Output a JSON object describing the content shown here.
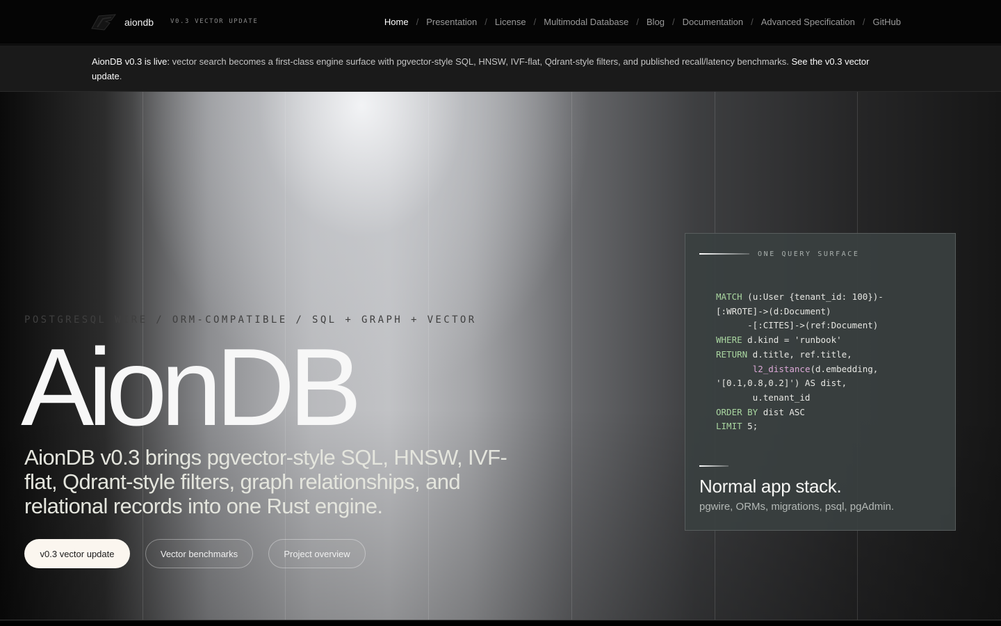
{
  "header": {
    "brand": "aiondb",
    "version_tag": "V0.3 VECTOR UPDATE",
    "logo_icon": "aiondb-logo-icon",
    "nav": [
      {
        "label": "Home",
        "active": true
      },
      {
        "label": "Presentation",
        "active": false
      },
      {
        "label": "License",
        "active": false
      },
      {
        "label": "Multimodal Database",
        "active": false
      },
      {
        "label": "Blog",
        "active": false
      },
      {
        "label": "Documentation",
        "active": false
      },
      {
        "label": "Advanced Specification",
        "active": false
      },
      {
        "label": "GitHub",
        "active": false
      }
    ],
    "separator": "/"
  },
  "announcement": {
    "lead": "AionDB v0.3 is live:",
    "body": " vector search becomes a first-class engine surface with pgvector-style SQL, HNSW, IVF-flat, Qdrant-style filters, and published recall/latency benchmarks. ",
    "link": "See the v0.3 vector update",
    "tail": "."
  },
  "hero": {
    "eyebrow": "POSTGRESQL WIRE / ORM-COMPATIBLE / SQL + GRAPH + VECTOR",
    "title": "AionDB",
    "subtitle": "AionDB v0.3 brings pgvector-style SQL, HNSW, IVF-flat, Qdrant-style filters, graph relationships, and relational records into one Rust engine.",
    "buttons": {
      "primary": "v0.3 vector update",
      "benchmarks": "Vector benchmarks",
      "overview": "Project overview"
    }
  },
  "query_card": {
    "label": "ONE QUERY SURFACE",
    "code_lines": [
      [
        {
          "t": "MATCH",
          "k": "kw"
        },
        {
          "t": " (u:User {tenant_id: 100})-"
        }
      ],
      [
        {
          "t": "[:WROTE]->(d:Document)"
        }
      ],
      [
        {
          "t": "      -[:CITES]->(ref:Document)"
        }
      ],
      [
        {
          "t": "WHERE",
          "k": "kw"
        },
        {
          "t": " d.kind = 'runbook'"
        }
      ],
      [
        {
          "t": "RETURN",
          "k": "kw"
        },
        {
          "t": " d.title, ref.title,"
        }
      ],
      [
        {
          "t": "       "
        },
        {
          "t": "l2_distance",
          "k": "fn"
        },
        {
          "t": "(d.embedding,"
        }
      ],
      [
        {
          "t": "'[0.1,0.8,0.2]') AS dist,"
        }
      ],
      [
        {
          "t": "       u.tenant_id"
        }
      ],
      [
        {
          "t": "ORDER BY",
          "k": "kw"
        },
        {
          "t": " dist ASC"
        }
      ],
      [
        {
          "t": "LIMIT",
          "k": "kw"
        },
        {
          "t": " 5;"
        }
      ]
    ],
    "title": "Normal app stack.",
    "subtitle": "pgwire, ORMs, migrations, psql, pgAdmin."
  },
  "colors": {
    "accent_keyword": "#a9d6a0",
    "accent_function": "#dba8d6",
    "primary_button": "#fbf6ef"
  }
}
